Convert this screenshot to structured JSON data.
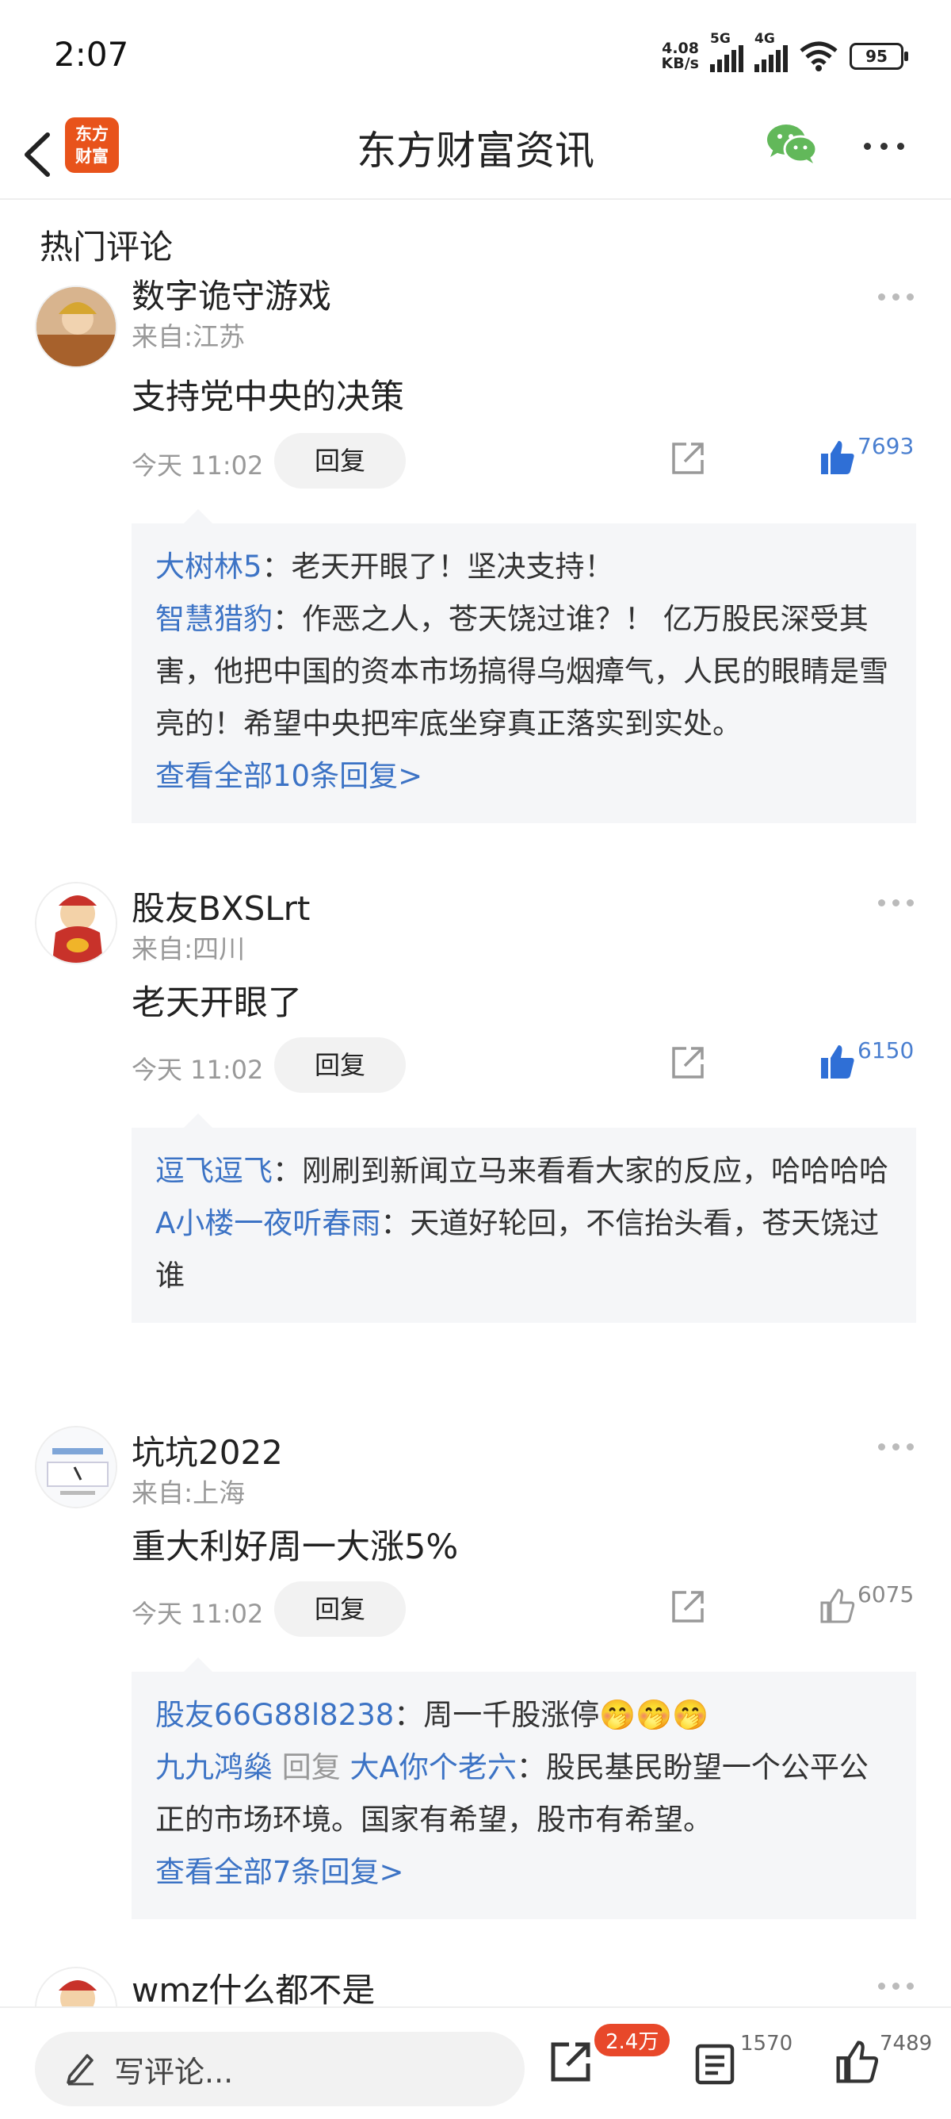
{
  "status_bar": {
    "time": "2:07",
    "net_speed_value": "4.08",
    "net_speed_unit": "KB/s",
    "sig1_label": "5G",
    "sig2_label": "4G",
    "battery": "95"
  },
  "nav": {
    "logo_line1": "东方",
    "logo_line2": "财富",
    "title": "东方财富资讯"
  },
  "section_title": "热门评论",
  "comments": [
    {
      "username": "数字诡守游戏",
      "location": "来自:江苏",
      "text": "支持党中央的决策",
      "time": "今天 11:02",
      "reply_label": "回复",
      "likes": "7693",
      "replies": [
        {
          "name": "大树林5",
          "text": "：老天开眼了！坚决支持！"
        },
        {
          "name": "智慧猎豹",
          "text": "：作恶之人，苍天饶过谁？！ 亿万股民深受其害，他把中国的资本市场搞得乌烟瘴气，人民的眼睛是雪亮的！希望中央把牢底坐穿真正落实到实处。"
        }
      ],
      "view_all": "查看全部10条回复>"
    },
    {
      "username": "股友BXSLrt",
      "location": "来自:四川",
      "text": "老天开眼了",
      "time": "今天 11:02",
      "reply_label": "回复",
      "likes": "6150",
      "replies": [
        {
          "name": "逗飞逗飞",
          "text": "：刚刷到新闻立马来看看大家的反应，哈哈哈哈"
        },
        {
          "name": "A小楼一夜听春雨",
          "text": "：天道好轮回，不信抬头看，苍天饶过谁"
        }
      ]
    },
    {
      "username": "坑坑2022",
      "location": "来自:上海",
      "text": "重大利好周一大涨5%",
      "time": "今天 11:02",
      "reply_label": "回复",
      "likes": "6075",
      "replies": [
        {
          "name": "股友66G88l8238",
          "text": "：周一千股涨停🤭🤭🤭"
        },
        {
          "name": "九九鸿燊",
          "mid": " 回复 ",
          "name2": "大A你个老六",
          "text": "：股民基民盼望一个公平公正的市场环境。国家有希望，股市有希望。"
        }
      ],
      "view_all": "查看全部7条回复>"
    },
    {
      "username": "wmz什么都不是"
    }
  ],
  "bottom_bar": {
    "placeholder": "写评论...",
    "share_badge": "2.4万",
    "comment_count": "1570",
    "like_count": "7489"
  },
  "colors": {
    "accent_blue": "#3c73c5",
    "like_blue": "#2f6fd6",
    "brand_orange": "#e8531b",
    "badge_red": "#e8482a",
    "wechat_green": "#62b85a"
  }
}
